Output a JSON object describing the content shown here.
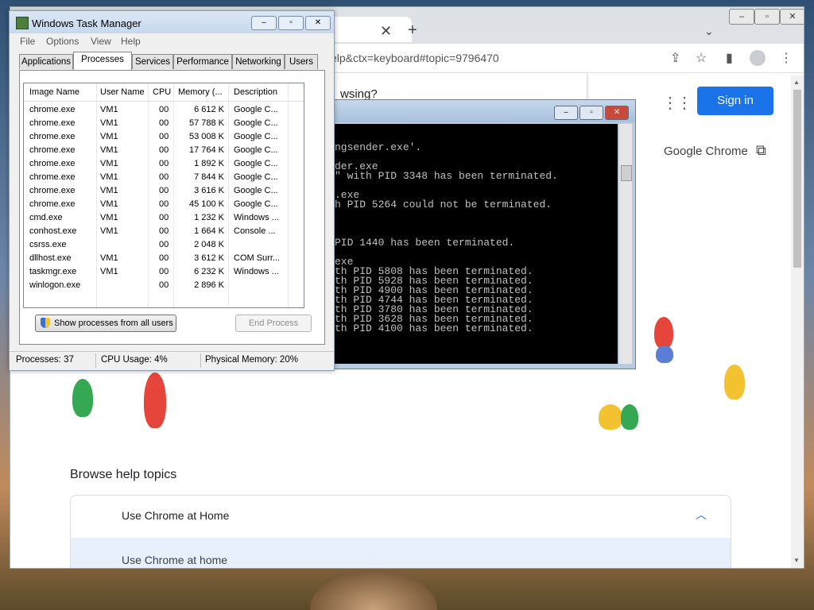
{
  "taskmanager": {
    "title": "Windows Task Manager",
    "menu": [
      "File",
      "Options",
      "View",
      "Help"
    ],
    "tabs": [
      "Applications",
      "Processes",
      "Services",
      "Performance",
      "Networking",
      "Users"
    ],
    "active_tab": "Processes",
    "columns": [
      "Image Name",
      "User Name",
      "CPU",
      "Memory (...",
      "Description"
    ],
    "rows": [
      [
        "chrome.exe",
        "VM1",
        "00",
        "6 612 K",
        "Google C..."
      ],
      [
        "chrome.exe",
        "VM1",
        "00",
        "57 788 K",
        "Google C..."
      ],
      [
        "chrome.exe",
        "VM1",
        "00",
        "53 008 K",
        "Google C..."
      ],
      [
        "chrome.exe",
        "VM1",
        "00",
        "17 764 K",
        "Google C..."
      ],
      [
        "chrome.exe",
        "VM1",
        "00",
        "1 892 K",
        "Google C..."
      ],
      [
        "chrome.exe",
        "VM1",
        "00",
        "7 844 K",
        "Google C..."
      ],
      [
        "chrome.exe",
        "VM1",
        "00",
        "3 616 K",
        "Google C..."
      ],
      [
        "chrome.exe",
        "VM1",
        "00",
        "45 100 K",
        "Google C..."
      ],
      [
        "cmd.exe",
        "VM1",
        "00",
        "1 232 K",
        "Windows ..."
      ],
      [
        "conhost.exe",
        "VM1",
        "00",
        "1 664 K",
        "Console ..."
      ],
      [
        "csrss.exe",
        "",
        "00",
        "2 048 K",
        ""
      ],
      [
        "dllhost.exe",
        "VM1",
        "00",
        "3 612 K",
        "COM Surr..."
      ],
      [
        "taskmgr.exe",
        "VM1",
        "00",
        "6 232 K",
        "Windows ..."
      ],
      [
        "winlogon.exe",
        "",
        "00",
        "2 896 K",
        ""
      ]
    ],
    "show_all_label": "Show processes from all users",
    "end_process_label": "End Process",
    "status": {
      "processes": "Processes: 37",
      "cpu": "CPU Usage: 4%",
      "memory": "Physical Memory: 20%"
    }
  },
  "cmd": {
    "lines": [
      "ngsender.exe'.",
      "",
      "der.exe",
      "\" with PID 3348 has been terminated.",
      "",
      ".exe",
      "h PID 5264 could not be terminated.",
      "",
      "",
      "",
      "PID 1440 has been terminated.",
      "",
      "exe",
      "th PID 5808 has been terminated.",
      "th PID 5928 has been terminated.",
      "th PID 4900 has been terminated.",
      "th PID 4744 has been terminated.",
      "th PID 3780 has been terminated.",
      "th PID 3628 has been terminated.",
      "th PID 4100 has been terminated."
    ]
  },
  "chrome": {
    "url_fragment": "elp&ctx=keyboard#topic=9796470",
    "popup_fragment": "wsing?",
    "signin_label": "Sign in",
    "google_chrome_label": "Google Chrome",
    "browse_title": "Browse help topics",
    "accordion_heading": "Use Chrome at Home",
    "accordion_item": "Use Chrome at home",
    "accent": "#1a73e8"
  }
}
